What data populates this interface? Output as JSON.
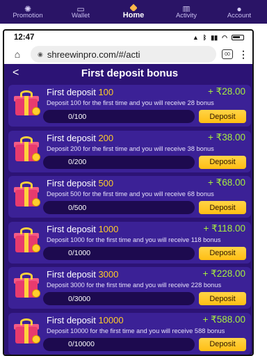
{
  "bottom_nav": [
    {
      "label": "Promotion",
      "icon": "promotion-icon"
    },
    {
      "label": "Wallet",
      "icon": "wallet-icon"
    },
    {
      "label": "Home",
      "icon": "home-gamepad-icon"
    },
    {
      "label": "Activity",
      "icon": "activity-icon"
    },
    {
      "label": "Account",
      "icon": "account-icon"
    }
  ],
  "status_bar": {
    "time": "12:47"
  },
  "browser": {
    "url": "shreewinpro.com/#/acti",
    "tab_count": "00"
  },
  "page": {
    "title": "First deposit bonus",
    "back_icon": "chevron-left-icon"
  },
  "bonuses": [
    {
      "title": "First deposit",
      "amount": "100",
      "reward": "+ ₹28.00",
      "desc": "Deposit 100 for the first time and you will receive 28 bonus",
      "progress": "0/100",
      "button": "Deposit"
    },
    {
      "title": "First deposit",
      "amount": "200",
      "reward": "+ ₹38.00",
      "desc": "Deposit 200 for the first time and you will receive 38 bonus",
      "progress": "0/200",
      "button": "Deposit"
    },
    {
      "title": "First deposit",
      "amount": "500",
      "reward": "+ ₹68.00",
      "desc": "Deposit 500 for the first time and you will receive 68 bonus",
      "progress": "0/500",
      "button": "Deposit"
    },
    {
      "title": "First deposit",
      "amount": "1000",
      "reward": "+ ₹118.00",
      "desc": "Deposit 1000 for the first time and you will receive 118 bonus",
      "progress": "0/1000",
      "button": "Deposit"
    },
    {
      "title": "First deposit",
      "amount": "3000",
      "reward": "+ ₹228.00",
      "desc": "Deposit 3000 for the first time and you will receive 228 bonus",
      "progress": "0/3000",
      "button": "Deposit"
    },
    {
      "title": "First deposit",
      "amount": "10000",
      "reward": "+ ₹588.00",
      "desc": "Deposit 10000 for the first time and you will receive 588 bonus",
      "progress": "0/10000",
      "button": "Deposit"
    }
  ],
  "colors": {
    "app_bg": "#2c1375",
    "card_bg": "#3b2196",
    "amount": "#ffcc29",
    "reward": "#a7ef3e",
    "button": "#ffc62b"
  }
}
